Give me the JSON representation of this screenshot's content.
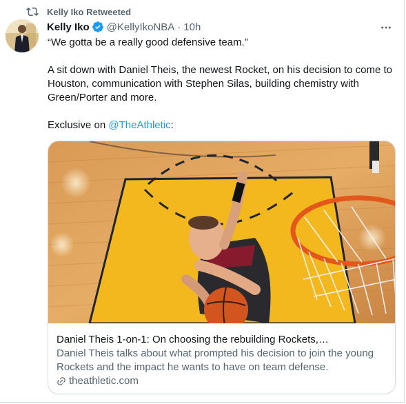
{
  "retweet_context": {
    "text": "Kelly Iko Retweeted"
  },
  "author": {
    "name": "Kelly Iko",
    "handle": "@KellyIkoNBA",
    "separator": "·",
    "time": "10h"
  },
  "tweet": {
    "line1": "“We gotta be a really good defensive team.”",
    "line2": "A sit down with Daniel Theis, the newest Rocket, on his decision to come to Houston, communication with Stephen Silas, building chemistry with Green/Porter and more.",
    "exclusive_prefix": "Exclusive on ",
    "mention": "@TheAthletic",
    "exclusive_suffix": ":"
  },
  "card": {
    "title": "Daniel Theis 1-on-1: On choosing the rebuilding Rockets,…",
    "description": "Daniel Theis talks about what prompted his decision to join the young Rockets and the impact he wants to have on team defense.",
    "domain": "theathletic.com"
  },
  "colors": {
    "accent": "#1d9bf0",
    "secondary_text": "#536471",
    "border": "#cfd9de"
  },
  "icons": {
    "retweet": "retweet-icon",
    "verified": "verified-badge-icon",
    "more": "more-options-icon",
    "link": "link-icon"
  }
}
